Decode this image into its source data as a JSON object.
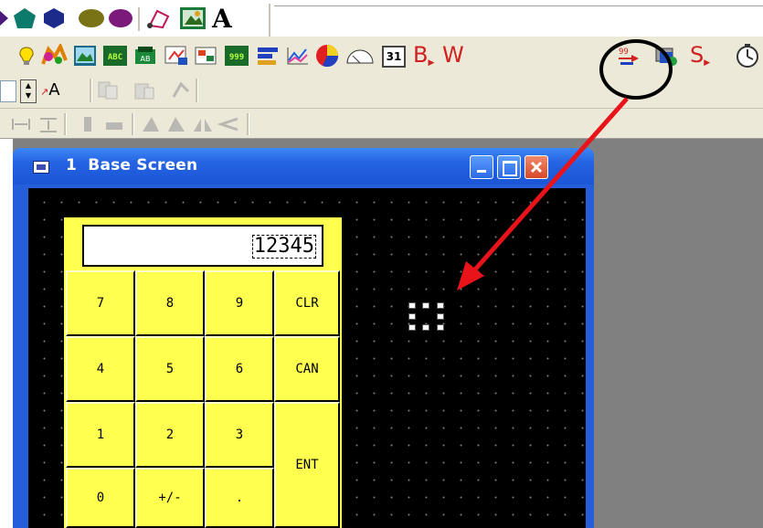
{
  "window": {
    "title_number": "1",
    "title": "Base Screen"
  },
  "display": {
    "value": "12345"
  },
  "keypad": {
    "k7": "7",
    "k8": "8",
    "k9": "9",
    "clr": "CLR",
    "k4": "4",
    "k5": "5",
    "k6": "6",
    "can": "CAN",
    "k1": "1",
    "k2": "2",
    "k3": "3",
    "ent": "ENT",
    "k0": "0",
    "sign": "+/-",
    "dot": "."
  },
  "toolbar": {
    "text_tool": "A",
    "bit_label": "B",
    "word_label": "W",
    "station_label": "S",
    "calendar_label": "31",
    "abc_label": "ABC",
    "num_label": "999"
  },
  "colors": {
    "keypad_yellow": "#ffff4f",
    "canvas": "#000000",
    "titlebar": "#245edb",
    "annotation_arrow": "#e8141a",
    "annotation_circle": "#000000"
  },
  "icons": [
    "shape-triangle-icon",
    "pentagon-icon",
    "hexagon-icon",
    "ellipse-icon",
    "polygon-icon",
    "picture-icon",
    "text-icon",
    "lamp-icon",
    "switch-icon",
    "image-icon",
    "abc-display-icon",
    "keypad-icon",
    "window-icon",
    "alarm-icon",
    "numeric-display-icon",
    "bar-graph-icon",
    "trend-graph-icon",
    "pie-chart-icon",
    "meter-icon",
    "calendar-icon",
    "bit-switch-icon",
    "word-switch-icon",
    "keypad-entry-icon",
    "data-transfer-icon",
    "station-icon",
    "timer-icon"
  ]
}
